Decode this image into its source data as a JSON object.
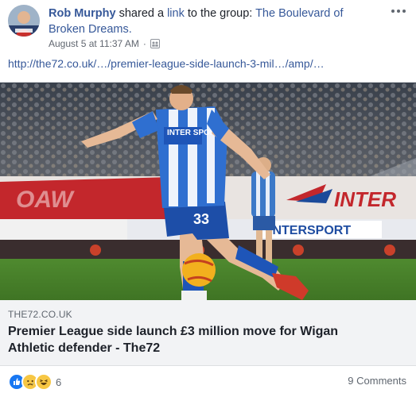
{
  "post": {
    "author": "Rob Murphy",
    "action_text": " shared a ",
    "link_word": "link",
    "to_text": " to the group: ",
    "group_name": "The Boulevard of Broken Dreams.",
    "timestamp": "August 5 at 11:37 AM",
    "separator": "·",
    "privacy_icon": "group-icon",
    "more_icon": "more-options-icon",
    "url_text": "http://the72.co.uk/…/premier-league-side-launch-3-mil…/amp/…"
  },
  "link_preview": {
    "domain": "THE72.CO.UK",
    "headline": "Premier League side launch £3 million move for Wigan Athletic defender - The72",
    "image_board_text_1": "INTER",
    "image_board_text_2": "INTERSPORT",
    "image_shirt_sponsor": "INTER SPORT",
    "image_shirt_number": "33"
  },
  "footer": {
    "reaction_icons": [
      "like-icon",
      "sad-icon",
      "haha-icon"
    ],
    "reaction_count": "6",
    "comments": "9 Comments"
  },
  "colors": {
    "link_blue": "#365899",
    "meta_gray": "#616770",
    "preview_bg": "#f2f3f5",
    "like_blue": "#1877f2",
    "emoji_yellow": "#f7c744"
  }
}
